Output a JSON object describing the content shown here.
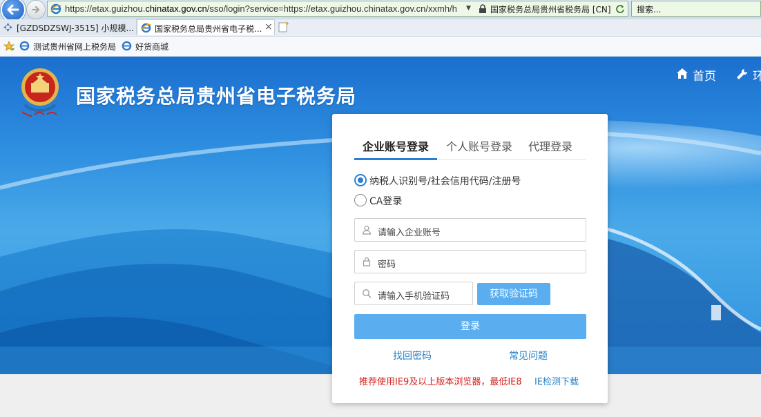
{
  "browser": {
    "address_prefix": "https://etax.guizhou.",
    "address_domain": "chinatax.gov.cn",
    "address_suffix": "/sso/login?service=https://etax.guizhou.chinatax.gov.cn/xxmh/h",
    "site_identity": "国家税务总局贵州省税务局 [CN]",
    "search_placeholder": "搜索...",
    "tabs": [
      {
        "label": "[GZDSDZSWJ-3515] 小规模..."
      },
      {
        "label": "国家税务总局贵州省电子税...",
        "close": "×"
      }
    ],
    "favorites": [
      {
        "label": "测试贵州省网上税务局"
      },
      {
        "label": "好货商城"
      }
    ]
  },
  "header": {
    "title": "国家税务总局贵州省电子税务局",
    "nav": [
      {
        "label": "首页",
        "icon": "home-icon"
      },
      {
        "label": "环",
        "icon": "wrench-icon"
      }
    ]
  },
  "login": {
    "tabs": [
      {
        "label": "企业账号登录",
        "active": true
      },
      {
        "label": "个人账号登录",
        "active": false
      },
      {
        "label": "代理登录",
        "active": false
      }
    ],
    "radios": [
      {
        "label": "纳税人识别号/社会信用代码/注册号",
        "checked": true
      },
      {
        "label": "CA登录",
        "checked": false
      }
    ],
    "account_placeholder": "请输入企业账号",
    "password_placeholder": "密码",
    "sms_placeholder": "请输入手机验证码",
    "get_code_label": "获取验证码",
    "login_label": "登录",
    "links": {
      "recover": "找回密码",
      "faq": "常见问题"
    },
    "notice": "推荐使用IE9及以上版本浏览器，最低IE8",
    "notice_link": "IE检测下载"
  },
  "colors": {
    "primary_blue": "#2a7fd5",
    "button_blue": "#5aaef0",
    "notice_red": "#d4221e",
    "link_blue": "#1f7fc8"
  }
}
